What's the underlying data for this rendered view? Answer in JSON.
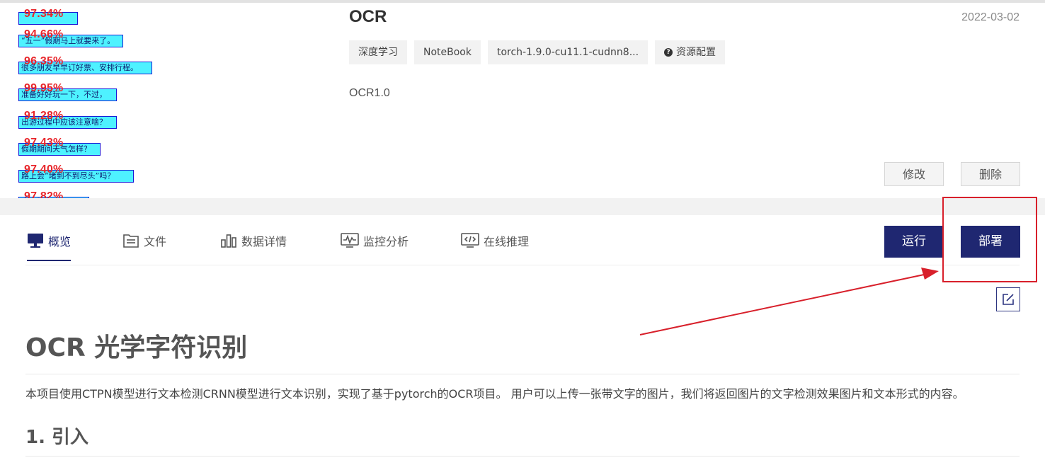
{
  "thumbnail": {
    "lines": [
      {
        "score": "97.34%",
        "text": ""
      },
      {
        "score": "94.66%",
        "text": "“五一”假期马上就要来了。"
      },
      {
        "score": "96.35%",
        "text": "很多朋友早早订好票、安排行程。"
      },
      {
        "score": "99.95%",
        "text": "准备好好玩一下，不过，"
      },
      {
        "score": "91.28%",
        "text": "出游过程中应该注意啥？"
      },
      {
        "score": "97.43%",
        "text": "假期期间天气怎样？"
      },
      {
        "score": "97.40%",
        "text": "路上会“堵到不到尽头”吗？"
      },
      {
        "score": "97.82%",
        "text": ""
      }
    ]
  },
  "header": {
    "title": "OCR",
    "date": "2022-03-02",
    "tags": [
      "深度学习",
      "NoteBook",
      "torch-1.9.0-cu11.1-cudnn8...",
      "资源配置"
    ],
    "description": "OCR1.0",
    "edit_label": "修改",
    "delete_label": "删除"
  },
  "tabs": [
    {
      "label": "概览",
      "icon": "monitor-icon",
      "active": true
    },
    {
      "label": "文件",
      "icon": "file-icon",
      "active": false
    },
    {
      "label": "数据详情",
      "icon": "bar-chart-icon",
      "active": false
    },
    {
      "label": "监控分析",
      "icon": "pulse-icon",
      "active": false
    },
    {
      "label": "在线推理",
      "icon": "code-icon",
      "active": false
    }
  ],
  "actions": {
    "run_label": "运行",
    "deploy_label": "部署"
  },
  "content": {
    "h1": "OCR 光学字符识别",
    "paragraph": "本项目使用CTPN模型进行文本检测CRNN模型进行文本识别，实现了基于pytorch的OCR项目。 用户可以上传一张带文字的图片，我们将返回图片的文字检测效果图片和文本形式的内容。",
    "h2": "1. 引入"
  },
  "colors": {
    "primary": "#1f2771",
    "annotation_red": "#d8202b",
    "ocr_box_fill": "#4ef2ff",
    "ocr_score": "#e8262b"
  }
}
